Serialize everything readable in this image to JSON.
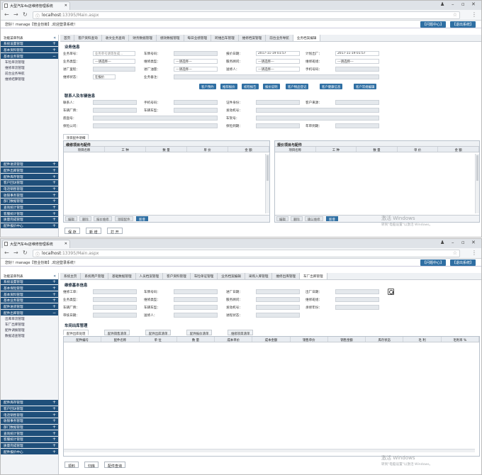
{
  "browser": {
    "tab_title": "大型汽车4s店维修管理系统",
    "url_host": "localhost",
    "url_rest": ":13395/Main.aspx"
  },
  "header": {
    "welcome": "您好！manage【管业份郎】,欢迎登录系统！",
    "btn_help": "【问题中心】",
    "btn_exit": "【退出系统】"
  },
  "screen1": {
    "sidebar_top": [
      "功能菜单列表",
      "系统设置管理",
      "基本资料管理",
      "基本业务管理"
    ],
    "sidebar_sub": [
      "车险单流管理",
      "维修单流管理",
      "前台业务导航",
      "维修结算管理"
    ],
    "sidebar_bottom": [
      "配件进货管理",
      "配件出库管理",
      "配件库存管理",
      "客户回访管理",
      "电话销售管理",
      "收银事务管理",
      "部门数据管理",
      "查询统计管理",
      "客服统计管理",
      "质量完成管理",
      "配件报价中心"
    ],
    "tabs": [
      "首页",
      "客户资料查询",
      "收文业务查询",
      "财务数据管理",
      "绩效数据管理",
      "每日业绩管理",
      "跨维出车管理",
      "维修档案管理",
      "前台业务导航",
      "业务档案编辑"
    ],
    "section_business": "业务信息",
    "f_order_no": "业务单号：",
    "f_order_no_val": "业务单号请等生成…",
    "f_car_no": "车牌号码：",
    "f_quote_date": "报价日期：",
    "f_quote_date_val": "2017-11-19 01:57",
    "f_plan_out": "计划出厂：",
    "f_plan_out_val": "2017-11-19 01:57",
    "f_biz_type": "业务类型：",
    "f_repair_type": "维修类型：",
    "f_advisor": "服务顾问：",
    "f_mechanic": "维修班组：",
    "f_in_mileage": "进厂里程：",
    "f_in_fuel": "进厂油量：",
    "f_sender": "送修人：",
    "f_phone": "手机号码：",
    "f_repair_status": "维修状态：",
    "f_repair_status_val": "在报价",
    "f_biz_note": "业务备注：",
    "select_placeholder": "---请选择---",
    "action_buttons": [
      "客户预约",
      "推荐报价",
      "初检报告",
      "报价说明",
      "客户物品登记",
      "客户健康信息",
      "客户常规编辑"
    ],
    "section_contact": "联系人及车辆信息",
    "c_contact": "联系人：",
    "c_mobile": "手机号码：",
    "c_id": "证件身份：",
    "c_source": "客户来源：",
    "c_brand": "车辆厂牌：",
    "c_model": "车辆车型：",
    "c_engine": "发动机号：",
    "c_vin": "底盘号：",
    "c_frame": "车架号：",
    "c_insurer": "保险公司：",
    "c_ins_date": "保险到期：",
    "c_annual": "年审到期：",
    "detail_tab": "项目配件明细",
    "left_panel_title": "维修项目与配件",
    "right_panel_title": "报价项目与配件",
    "cols": [
      "项目名称",
      "工 种",
      "数 量",
      "单 价",
      "金 额"
    ],
    "left_foot_buttons": [
      "编辑",
      "删除",
      "报价维修",
      "领取配件"
    ],
    "left_foot_new": "新增",
    "right_foot_buttons": [
      "编辑",
      "删除",
      "确认维修"
    ],
    "right_foot_new": "新增",
    "bottom_buttons": [
      "保 存",
      "新 增",
      "打 开"
    ]
  },
  "screen2": {
    "sidebar_top": [
      "功能菜单列表",
      "系统设置管理",
      "基本保险管理",
      "基本资料管理",
      "基本业务管理",
      "配件进货管理",
      "配件出库管理"
    ],
    "sidebar_sub": [
      "出库单流管理",
      "车厂出库管理",
      "配件调拨管理",
      "数据适查管理"
    ],
    "sidebar_bottom": [
      "配件库存管理",
      "客户回访管理",
      "电话销售管理",
      "收银事务管理",
      "部门数据管理",
      "查询统计管理",
      "客服统计管理",
      "质量完成管理",
      "配件报价中心"
    ],
    "tabs": [
      "系统主页",
      "系统用户管理",
      "基础数据管理",
      "人员档案管理",
      "客户资料管理",
      "车险单证管理",
      "业务档案编辑",
      "采购入库管理",
      "维修出库管理",
      "车厂出库管理"
    ],
    "section_title": "维修基本信息",
    "f_work_order": "维修工单：",
    "f_car_no": "车牌号码：",
    "f_in_date": "进厂日期：",
    "f_out_date": "出厂日期：",
    "f_biz_type": "业务类型：",
    "f_repair_type": "维修类型：",
    "f_advisor": "服务顾问：",
    "f_mechanic": "维修班组：",
    "f_brand": "车辆厂牌：",
    "f_model": "车辆车型：",
    "f_engine": "发动机号：",
    "f_payer": "承修年份：",
    "f_audit": "审核日期：",
    "f_sender": "送修人：",
    "f_status": "进程状态：",
    "sub_title": "车间出库管理",
    "sub_tabs": [
      "配件出库处理",
      "配件销售清单",
      "配件出库清单",
      "配件报价清单",
      "维修项目清单"
    ],
    "cols": [
      "配件编号",
      "配件名称",
      "单 位",
      "数 量",
      "成本单价",
      "成本金额",
      "销售单价",
      "销售金额",
      "库存状态",
      "毛 利",
      "毛利率 %"
    ],
    "bottom_buttons": [
      "领料",
      "归库",
      "配件查询"
    ]
  },
  "watermark": {
    "line1": "激活 Windows",
    "line2": "转到\"电脑设置\"以激活 Windows。"
  },
  "colors": {
    "primary": "#1f4f7a",
    "button": "#2f6fa3"
  }
}
